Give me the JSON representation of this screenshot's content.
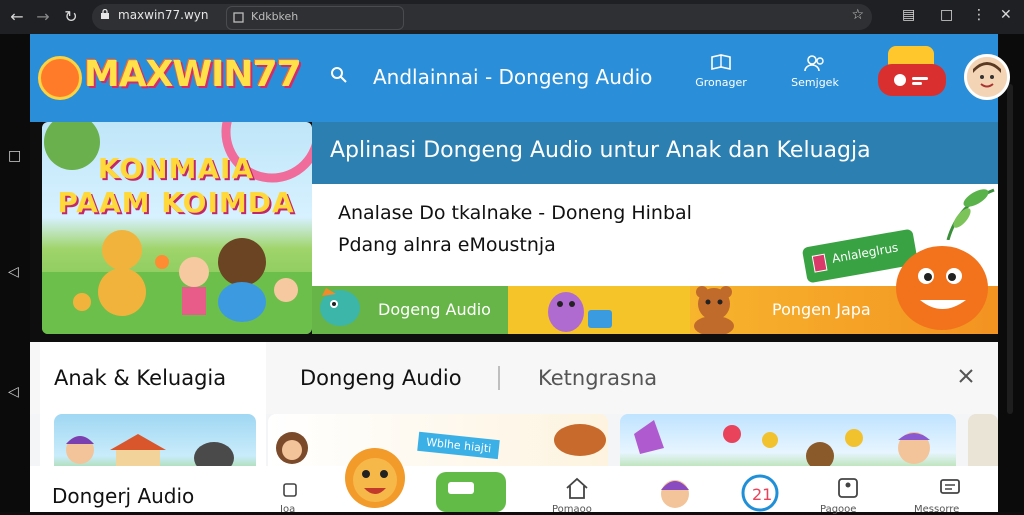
{
  "browser": {
    "url": "maxwin77.wyn",
    "tab_label": "Kdkbkeh"
  },
  "header": {
    "logo_text": "MAXWIN77",
    "title": "Andlainnai - Dongeng Audio",
    "buttons": [
      {
        "label": "Gronager",
        "icon": "book-icon"
      },
      {
        "label": "Semjgek",
        "icon": "users-icon"
      }
    ]
  },
  "hero": {
    "image_title_line1": "KONMAIA",
    "image_title_line2": "PAAM KOIMDA",
    "banner": "Aplinasi Dongeng Audio untur Anak dan Keluagja",
    "line1": "Analase Do tkalnake - Doneng Hinbal",
    "line2": "Pdang alnra eMoustnja",
    "tag": "Anlaleglrus",
    "strip_green": "Dogeng Audio",
    "strip_orange": "Pongen Japa"
  },
  "tabs": [
    {
      "label": "Anak & Keluagia"
    },
    {
      "label": "Dongeng Audio"
    },
    {
      "label": "Ketngrasna"
    }
  ],
  "cards": {
    "first_label": "Dongerj Audio",
    "badge_text": "Wblhe hiajti"
  },
  "bottom_nav": [
    {
      "label": "Ioa"
    },
    {
      "label": "Pomaoo"
    },
    {
      "label": "Pagooe"
    },
    {
      "label": "Messorre"
    }
  ],
  "colors": {
    "header_bg": "#2a8fd8",
    "banner_bg": "#2b7fb1",
    "green": "#67b548",
    "yellow": "#f5c428",
    "orange": "#f39321"
  }
}
